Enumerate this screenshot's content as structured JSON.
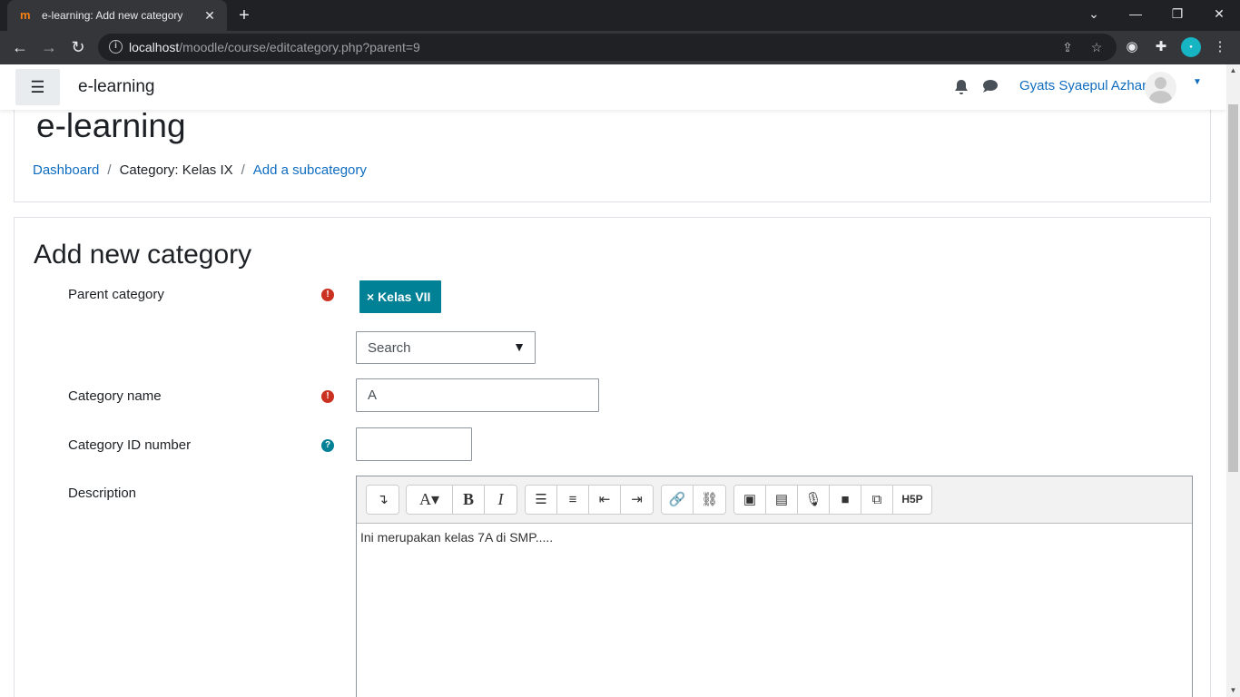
{
  "browser": {
    "tab_title": "e-learning: Add new category",
    "favicon_text": "m",
    "url_host": "localhost",
    "url_path": "/moodle/course/editcategory.php?parent=9"
  },
  "navbar": {
    "brand": "e-learning",
    "user_name": "Gyats Syaepul Azhar"
  },
  "header": {
    "title": "e-learning",
    "breadcrumb": [
      {
        "label": "Dashboard"
      },
      {
        "label": "Category: Kelas IX"
      },
      {
        "label": "Add a subcategory"
      }
    ]
  },
  "form": {
    "title": "Add new category",
    "parent_label": "Parent category",
    "parent_selected": "× Kelas VII",
    "search_placeholder": "Search",
    "name_label": "Category name",
    "name_value": "A",
    "idnumber_label": "Category ID number",
    "idnumber_value": "",
    "description_label": "Description",
    "description_text": "Ini merupakan kelas 7A di SMP.....",
    "h5p_label": "H5P",
    "required_mark": "!",
    "help_mark": "?"
  },
  "colors": {
    "accent_link": "#0f6cbf",
    "tag_bg": "#008196",
    "required": "#ca3120"
  }
}
